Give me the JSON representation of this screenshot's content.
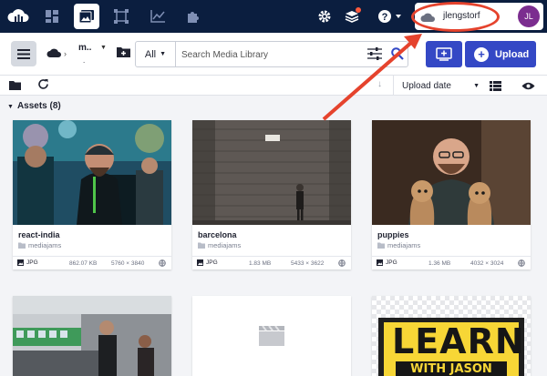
{
  "nav": {
    "account_name": "jlengstorf",
    "avatar_initials": "JL"
  },
  "toolbar": {
    "breadcrumb_label": "m..",
    "breadcrumb_sub": ".",
    "search_scope": "All",
    "search_placeholder": "Search Media Library",
    "upload_label": "Upload"
  },
  "subbar": {
    "sort_label": "Upload date"
  },
  "assets": {
    "header": "Assets (8)",
    "items": [
      {
        "name": "react-india",
        "folder": "mediajams",
        "type": "JPG",
        "size": "862.07 KB",
        "dimensions": "5760 × 3840"
      },
      {
        "name": "barcelona",
        "folder": "mediajams",
        "type": "JPG",
        "size": "1.83 MB",
        "dimensions": "5433 × 3622"
      },
      {
        "name": "puppies",
        "folder": "mediajams",
        "type": "JPG",
        "size": "1.36 MB",
        "dimensions": "4032 × 3024"
      }
    ],
    "learn_card": {
      "line1": "LEARN",
      "line2": "WITH JASON"
    }
  },
  "colors": {
    "nav_bg": "#0b1e3f",
    "accent": "#3448c5",
    "annotation": "#e5432d",
    "avatar": "#7b2d8f"
  }
}
